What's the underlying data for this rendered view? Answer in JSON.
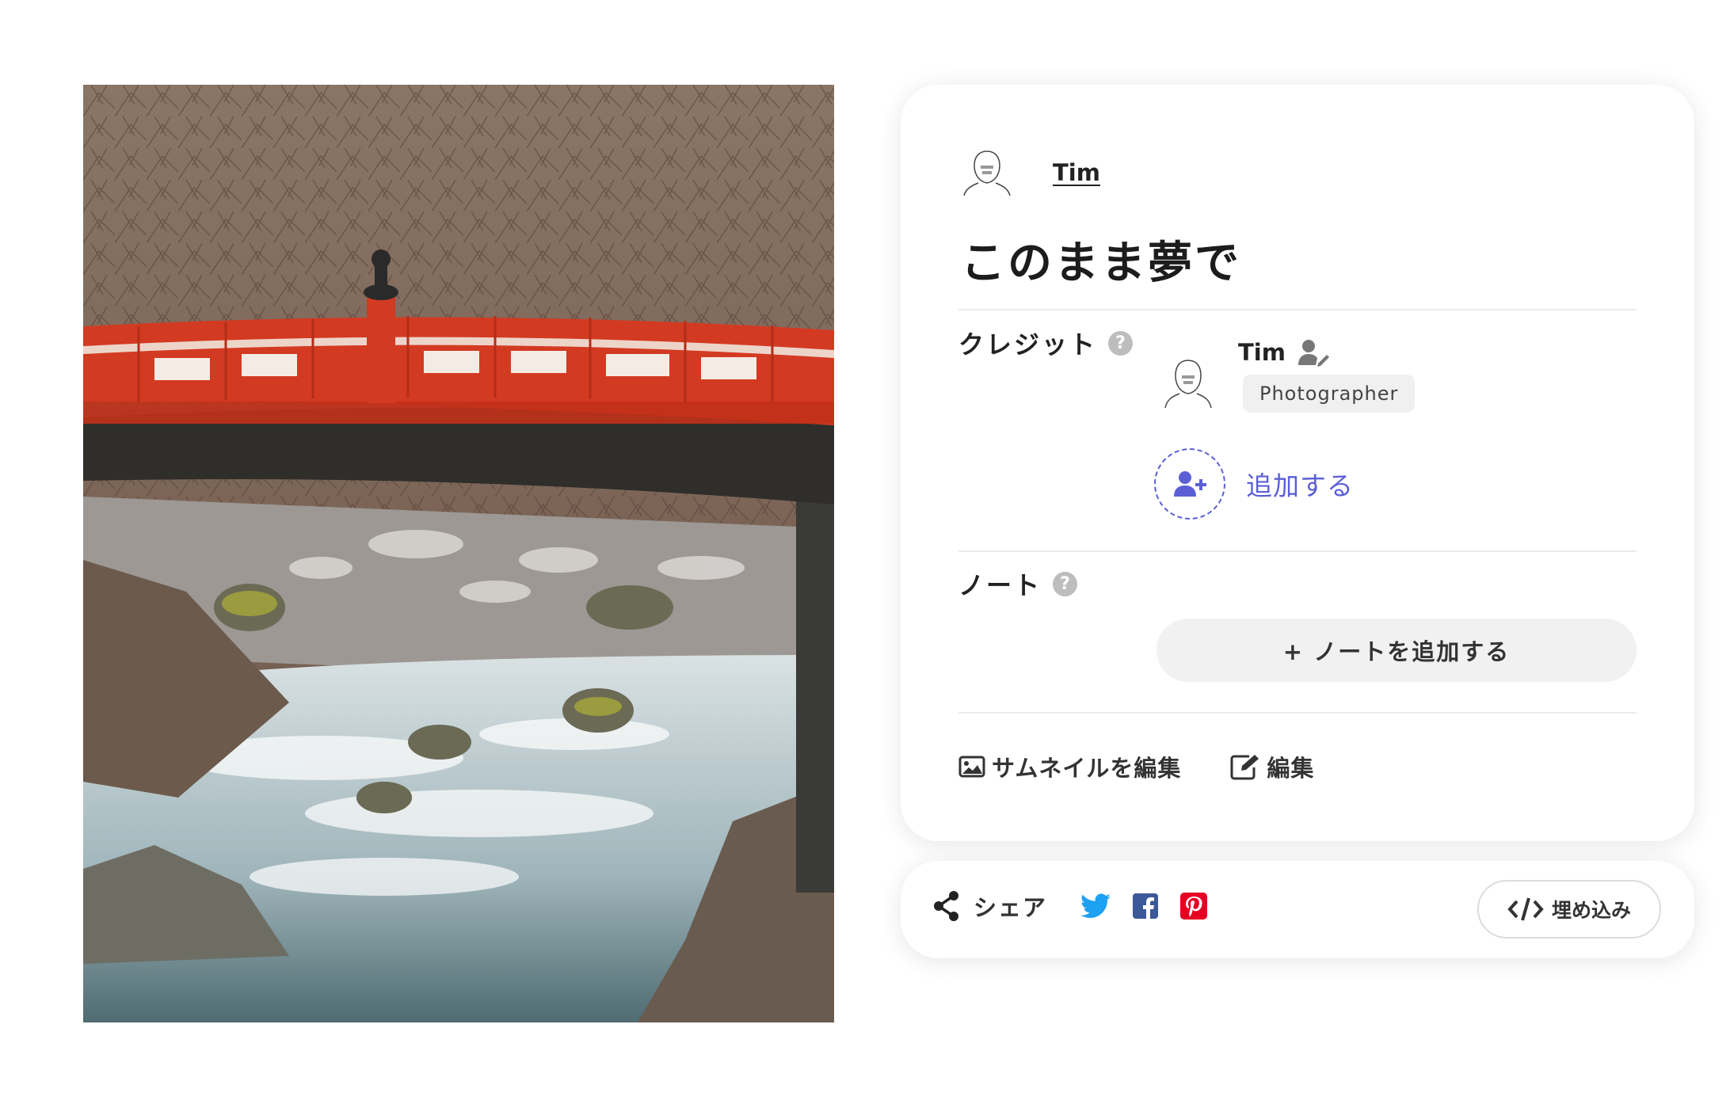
{
  "post": {
    "author_name": "Tim",
    "title": "このまま夢で",
    "photo_alt": "red bridge over river photo"
  },
  "credits": {
    "label": "クレジット",
    "help": "?",
    "person_name": "Tim",
    "role": "Photographer",
    "add_label": "追加する"
  },
  "notes": {
    "label": "ノート",
    "help": "?",
    "add_button": "+ ノートを追加する"
  },
  "actions": {
    "edit_thumbnail": "サムネイルを編集",
    "edit": "編集"
  },
  "share": {
    "label": "シェア",
    "embed": "埋め込み"
  },
  "colors": {
    "accent": "#5b5fd6",
    "twitter": "#1da1f2",
    "facebook": "#3b5998",
    "pinterest": "#e60023"
  }
}
